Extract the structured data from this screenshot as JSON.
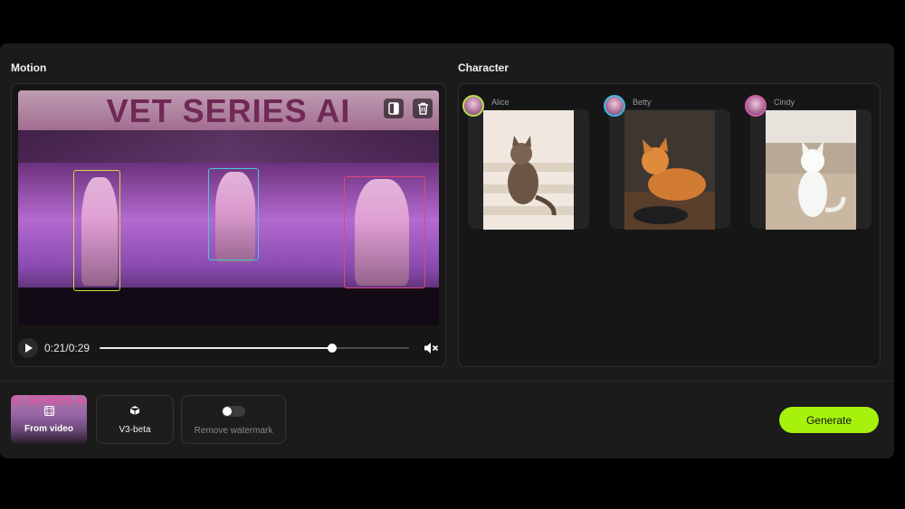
{
  "motion": {
    "title": "Motion",
    "video_overlay_text": "VET SERIES AI",
    "player": {
      "time": "0:21/0:29",
      "progress": 0.75
    },
    "tracked_colors": [
      "#cddc39",
      "#48c9d6",
      "#e0457b"
    ]
  },
  "character": {
    "title": "Character",
    "cards": [
      {
        "name": "Alice",
        "ring_color": "#b6e04a"
      },
      {
        "name": "Betty",
        "ring_color": "#3fb8e6"
      },
      {
        "name": "Cindy",
        "ring_color": "#d65aa8"
      }
    ]
  },
  "footer": {
    "source_label": "From video",
    "source_thumb_text": "EI SERIES AI",
    "model_label": "V3-beta",
    "watermark_label": "Remove watermark",
    "generate_label": "Generate"
  },
  "colors": {
    "accent": "#a6f20d",
    "panel": "#1b1b1b"
  },
  "icons": [
    "split-icon",
    "trash-icon",
    "play-icon",
    "mute-icon",
    "cube-icon",
    "video-grid-icon"
  ]
}
